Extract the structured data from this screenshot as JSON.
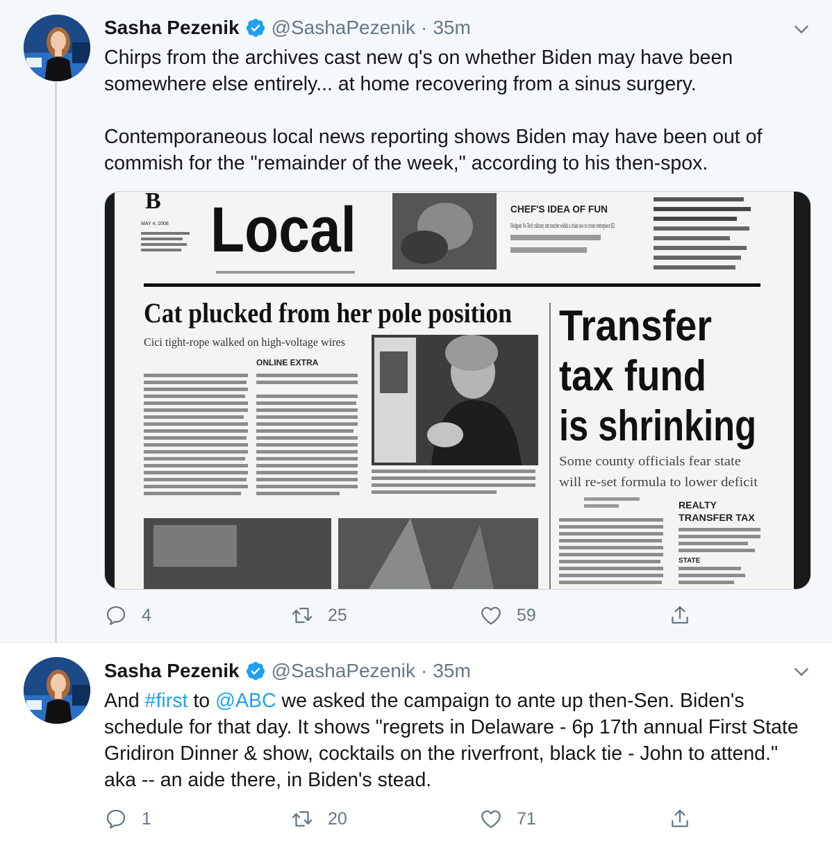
{
  "tweets": [
    {
      "author_name": "Sasha Pezenik",
      "handle": "@SashaPezenik",
      "separator": "·",
      "time": "35m",
      "paragraphs": [
        "Chirps from the archives cast new q's on whether Biden may have been somewhere else entirely... at home recovering from a sinus surgery.",
        "Contemporaneous local news reporting shows Biden may have been out of commish for the \"remainder of the week,\" according to his then-spox."
      ],
      "image": {
        "section_letter": "B",
        "section_title": "Local",
        "date": "MAY 4, 2008",
        "promo_headline": "CHEF'S IDEA OF FUN",
        "promo_text": "Hodgson Vo-Tech culinary arts teacher wields a chain saw to create centerpiece B2",
        "headline_left": "Cat plucked from her pole position",
        "subhead_left": "Cici tight-rope walked on high-voltage wires",
        "online_extra": "ONLINE EXTRA",
        "headline_right_lines": [
          "Transfer",
          "tax fund",
          "is shrinking"
        ],
        "subhead_right_lines": [
          "Some county officials fear state",
          "will re-set formula to lower deficit"
        ],
        "sidebar_label_lines": [
          "REALTY",
          "TRANSFER TAX"
        ],
        "state_label": "STATE"
      },
      "replies": "4",
      "retweets": "25",
      "likes": "59"
    },
    {
      "author_name": "Sasha Pezenik",
      "handle": "@SashaPezenik",
      "separator": "·",
      "time": "35m",
      "text_parts": {
        "p1": "And ",
        "hashtag": "#first",
        "p2": " to ",
        "mention": "@ABC",
        "p3": " we asked the campaign to ante up then-Sen. Biden's schedule for that day. It shows \"regrets in Delaware - 6p 17th annual First State Gridiron Dinner & show, cocktails on the riverfront, black tie - John to attend.\" aka -- an aide there, in Biden's stead."
      },
      "replies": "1",
      "retweets": "20",
      "likes": "71"
    }
  ],
  "colors": {
    "accent": "#1da1f2",
    "secondary_text": "#657786",
    "thread_line": "#ccd6dd",
    "first_tweet_bg": "#f5f8fa"
  },
  "icons": [
    "verified-badge-icon",
    "chevron-down-icon",
    "reply-icon",
    "retweet-icon",
    "like-icon",
    "share-icon"
  ]
}
